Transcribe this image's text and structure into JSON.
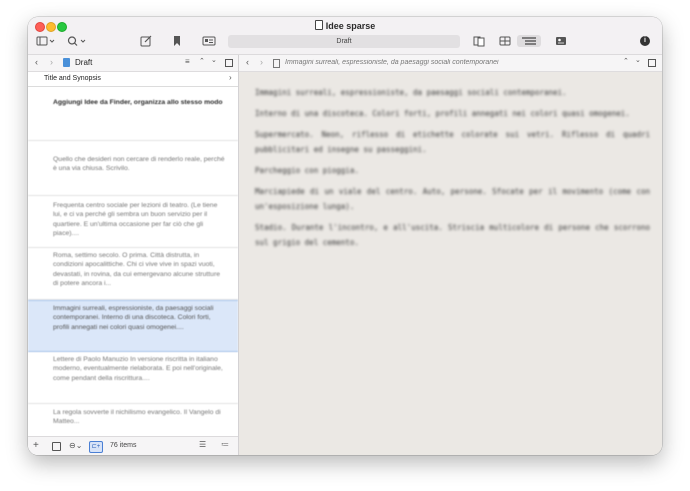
{
  "window": {
    "title": "Idee sparse"
  },
  "toolbar": {
    "center_label": "Draft",
    "info_label": "i"
  },
  "binder": {
    "folder": "Draft",
    "synopsis_header": "Title and Synopsis",
    "cards": [
      {
        "text": "Aggiungi Idee da Finder, organizza allo stesso modo",
        "style": "bold"
      },
      {
        "text": "Quello che desideri non cercare di renderlo reale, perché è una via chiusa. Scrivilo.",
        "style": "normal"
      },
      {
        "text": "Frequenta centro sociale per lezioni di teatro. (Le tiene lui, e ci va perché gli sembra un buon servizio per il quartiere. E un'ultima occasione per far ciò che gli piace)....",
        "style": "normal"
      },
      {
        "text": "Roma, settimo secolo. O prima. Città distrutta, in condizioni apocalittiche. Chi ci vive vive in spazi vuoti, devastati, in rovina, da cui emergevano alcune strutture di potere ancora i...",
        "style": "normal"
      },
      {
        "text": "Immagini surreali, espressioniste, da paesaggi sociali contemporanei. Interno di una discoteca. Colori forti, profili annegati nei colori quasi omogenei....",
        "style": "selected"
      },
      {
        "text": "Lettere di Paolo Manuzio In versione riscritta in italiano moderno, eventualmente rielaborata. E poi nell'originale, come pendant della riscrittura....",
        "style": "normal"
      },
      {
        "text": "La regola sovverte il nichilismo evangelico. Il Vangelo di Matteo...",
        "style": "normal"
      }
    ],
    "item_count": "76 items"
  },
  "editor": {
    "breadcrumb": "Immagini surreali, espressioniste, da paesaggi sociali contemporanei",
    "paragraphs": [
      "Immagini surreali, espressioniste, da paesaggi sociali contemporanei.",
      "Interno di una discoteca. Colori forti, profili annegati nei colori quasi omogenei.",
      "Supermercato. Neon, riflesso di etichette colorate sui vetri. Riflesso di quadri pubblicitari ed insegne su passeggini.",
      "Parcheggio con pioggia.",
      "Marciapiede di un viale del centro. Auto, persone. Sfocate per il movimento (come con un'esposizione lunga).",
      "Stadio. Durante l'incontro, e all'uscita. Striscia multicolore di persone che scorrono sul grigio del cemento."
    ]
  },
  "colors": {
    "selection": "#dbe7f9",
    "editor_bg": "#ebe8e4"
  }
}
